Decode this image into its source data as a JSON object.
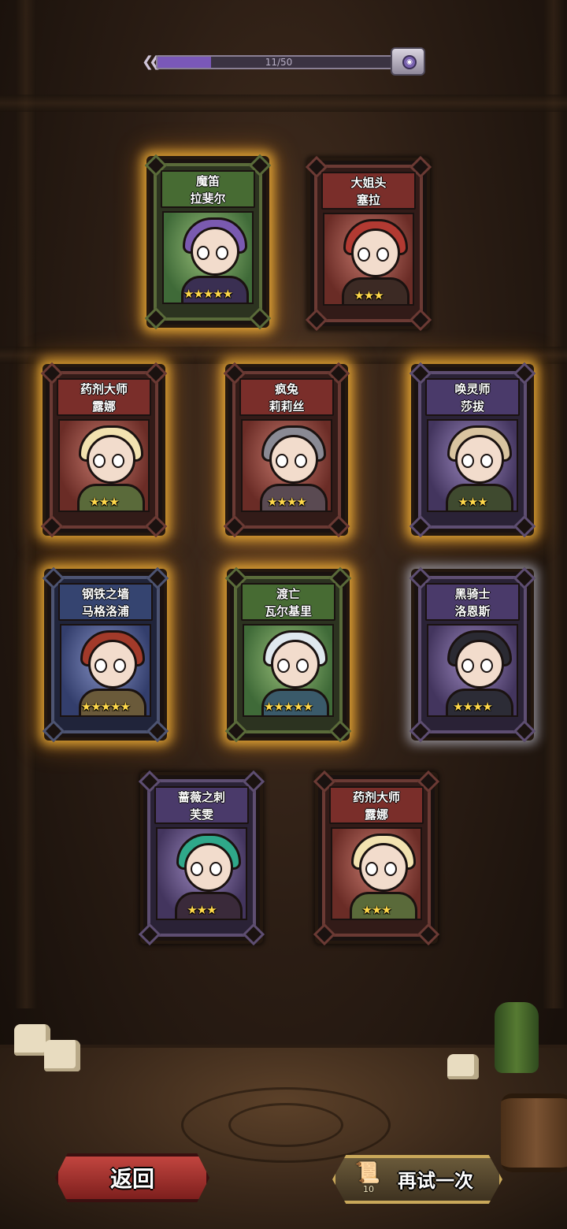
{
  "progress": {
    "text": "11/50",
    "current": 11,
    "total": 50,
    "fill_color": "#7a58b8",
    "chest_icon": "treasure-chest-icon"
  },
  "cards": [
    {
      "title": "魔笛",
      "name": "拉斐尔",
      "stars": 5,
      "stars_text": "★★★★★",
      "theme": "green",
      "glow": "gold",
      "hair": "#7a5ab0",
      "outfit": "#3a2f52"
    },
    {
      "title": "大姐头",
      "name": "塞拉",
      "stars": 3,
      "stars_text": "★★★",
      "theme": "red",
      "glow": "none",
      "hair": "#b23a32",
      "outfit": "#3c2a24"
    },
    {
      "title": "药剂大师",
      "name": "露娜",
      "stars": 3,
      "stars_text": "★★★",
      "theme": "red",
      "glow": "gold",
      "hair": "#f2e2b0",
      "outfit": "#5a6a3a"
    },
    {
      "title": "疯兔",
      "name": "莉莉丝",
      "stars": 4,
      "stars_text": "★★★★",
      "theme": "red",
      "glow": "gold",
      "hair": "#8a8a94",
      "outfit": "#5a4a52"
    },
    {
      "title": "唤灵师",
      "name": "莎拔",
      "stars": 3,
      "stars_text": "★★★",
      "theme": "purple",
      "glow": "gold",
      "hair": "#d9c4a0",
      "outfit": "#3f4a2f"
    },
    {
      "title": "钢铁之墙",
      "name": "马格洛浦",
      "stars": 5,
      "stars_text": "★★★★★",
      "theme": "blue",
      "glow": "gold",
      "hair": "#a23a2a",
      "outfit": "#6a5a3a"
    },
    {
      "title": "渡亡",
      "name": "瓦尔基里",
      "stars": 5,
      "stars_text": "★★★★★",
      "theme": "green",
      "glow": "gold",
      "hair": "#dfe8ee",
      "outfit": "#3a5a6a"
    },
    {
      "title": "黑骑士",
      "name": "洛恩斯",
      "stars": 4,
      "stars_text": "★★★★",
      "theme": "purple",
      "glow": "white",
      "hair": "#2a2a32",
      "outfit": "#2c2c36"
    },
    {
      "title": "蔷薇之刺",
      "name": "芙雯",
      "stars": 3,
      "stars_text": "★★★",
      "theme": "purple",
      "glow": "none",
      "hair": "#2fa88a",
      "outfit": "#3a2a3a"
    },
    {
      "title": "药剂大师",
      "name": "露娜",
      "stars": 3,
      "stars_text": "★★★",
      "theme": "red",
      "glow": "none",
      "hair": "#f2e2b0",
      "outfit": "#5a6a3a"
    }
  ],
  "buttons": {
    "back_label": "返回",
    "retry_label": "再试一次",
    "retry_cost": "10",
    "retry_icon": "summon-scroll-icon"
  }
}
